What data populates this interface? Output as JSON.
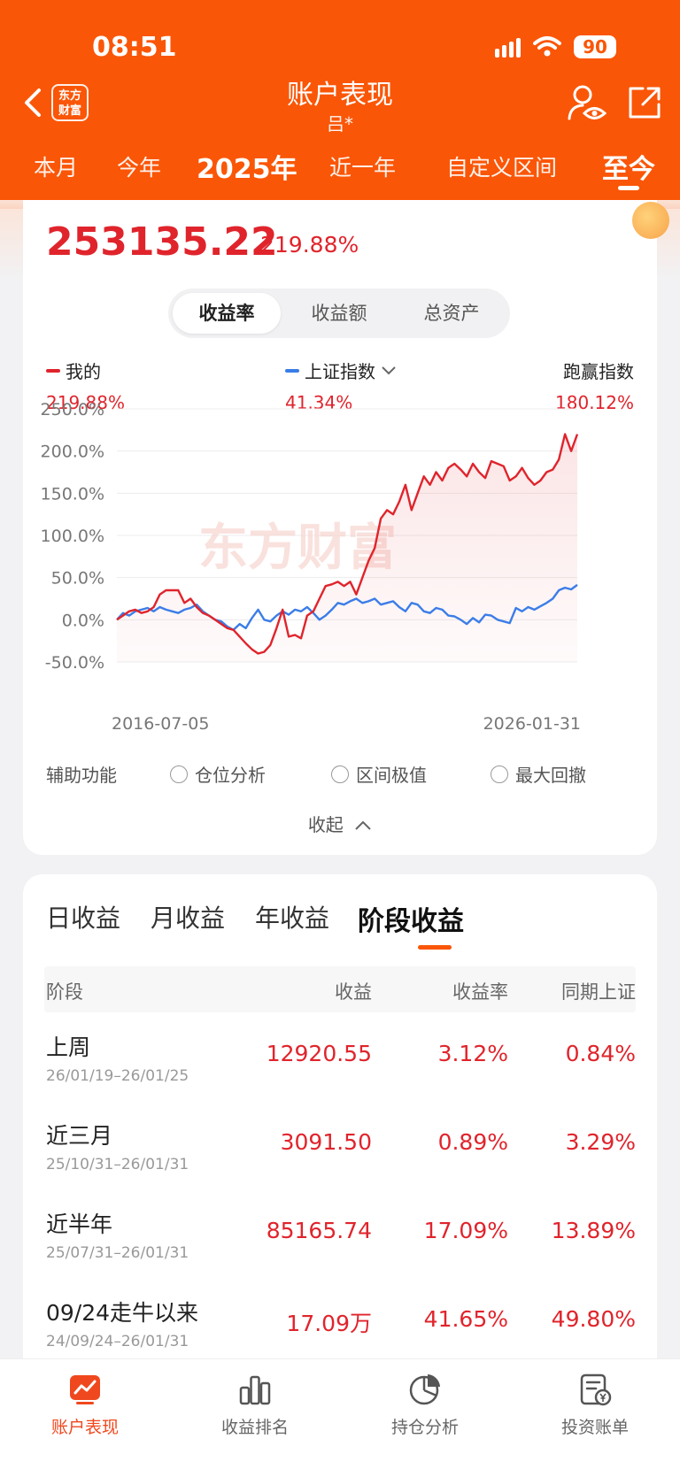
{
  "status": {
    "time": "08:51",
    "battery": "90"
  },
  "header": {
    "title": "账户表现",
    "subtitle": "吕*",
    "logo_text_line1": "东方",
    "logo_text_line2": "财富",
    "range_tabs": [
      "本月",
      "今年",
      "2025年",
      "近一年",
      "自定义区间",
      "至今"
    ],
    "active_range": "至今"
  },
  "summary": {
    "total": "253135.22",
    "rate": "219.88%"
  },
  "segment": {
    "items": [
      "收益率",
      "收益额",
      "总资产"
    ],
    "active": "收益率"
  },
  "legend": {
    "mine": {
      "label": "我的",
      "value": "219.88%",
      "color": "#e0242c"
    },
    "index": {
      "label": "上证指数",
      "value": "41.34%",
      "color": "#3b7de8"
    },
    "beat": {
      "label": "跑赢指数",
      "value": "180.12%"
    }
  },
  "watermark": "东方财富",
  "chart_data": {
    "type": "line",
    "x_start_label": "2016-07-05",
    "x_end_label": "2026-01-31",
    "yticks": [
      "250.0%",
      "200.0%",
      "150.0%",
      "100.0%",
      "50.0%",
      "0.0%",
      "-50.0%"
    ],
    "ylim": [
      -50,
      250
    ],
    "series": [
      {
        "name": "我的",
        "color": "#e0242c",
        "values": [
          0,
          5,
          10,
          12,
          8,
          10,
          15,
          30,
          35,
          35,
          35,
          20,
          25,
          15,
          8,
          5,
          0,
          -5,
          -10,
          -12,
          -20,
          -28,
          -35,
          -40,
          -38,
          -30,
          -10,
          12,
          -20,
          -18,
          -22,
          5,
          10,
          25,
          40,
          42,
          45,
          40,
          45,
          30,
          50,
          70,
          85,
          120,
          130,
          125,
          140,
          160,
          130,
          150,
          170,
          160,
          175,
          165,
          180,
          185,
          178,
          170,
          185,
          175,
          168,
          188,
          185,
          182,
          165,
          170,
          180,
          168,
          160,
          165,
          175,
          178,
          190,
          220,
          200,
          220
        ]
      },
      {
        "name": "上证指数",
        "color": "#3b7de8",
        "values": [
          0,
          8,
          5,
          10,
          12,
          14,
          10,
          15,
          12,
          10,
          8,
          12,
          14,
          18,
          10,
          5,
          0,
          -2,
          -8,
          -12,
          -5,
          -10,
          2,
          12,
          0,
          -2,
          5,
          10,
          6,
          12,
          10,
          15,
          8,
          0,
          5,
          12,
          20,
          18,
          22,
          25,
          20,
          22,
          25,
          18,
          20,
          22,
          15,
          10,
          20,
          18,
          10,
          8,
          14,
          12,
          5,
          4,
          0,
          -5,
          2,
          -3,
          6,
          5,
          0,
          -2,
          -4,
          14,
          10,
          15,
          12,
          16,
          20,
          25,
          35,
          38,
          36,
          41.34
        ]
      }
    ]
  },
  "aux": {
    "label": "辅助功能",
    "options": [
      "仓位分析",
      "区间极值",
      "最大回撤"
    ]
  },
  "collapse_label": "收起",
  "returns": {
    "tabs": [
      "日收益",
      "月收益",
      "年收益",
      "阶段收益"
    ],
    "active": "阶段收益",
    "columns": [
      "阶段",
      "收益",
      "收益率",
      "同期上证"
    ],
    "rows": [
      {
        "name": "上周",
        "dates": "26/01/19–26/01/25",
        "profit": "12920.55",
        "rate": "3.12%",
        "index": "0.84%"
      },
      {
        "name": "近三月",
        "dates": "25/10/31–26/01/31",
        "profit": "3091.50",
        "rate": "0.89%",
        "index": "3.29%"
      },
      {
        "name": "近半年",
        "dates": "25/07/31–26/01/31",
        "profit": "85165.74",
        "rate": "17.09%",
        "index": "13.89%"
      },
      {
        "name": "09/24走牛以来",
        "dates": "24/09/24–26/01/31",
        "profit": "17.09万",
        "rate": "41.65%",
        "index": "49.80%"
      }
    ]
  },
  "bottom_nav": {
    "items": [
      {
        "label": "账户表现",
        "icon": "chart-screen-icon"
      },
      {
        "label": "收益排名",
        "icon": "bar-ranking-icon"
      },
      {
        "label": "持仓分析",
        "icon": "pie-chart-icon"
      },
      {
        "label": "投资账单",
        "icon": "bill-yen-icon"
      }
    ],
    "active": "账户表现"
  }
}
